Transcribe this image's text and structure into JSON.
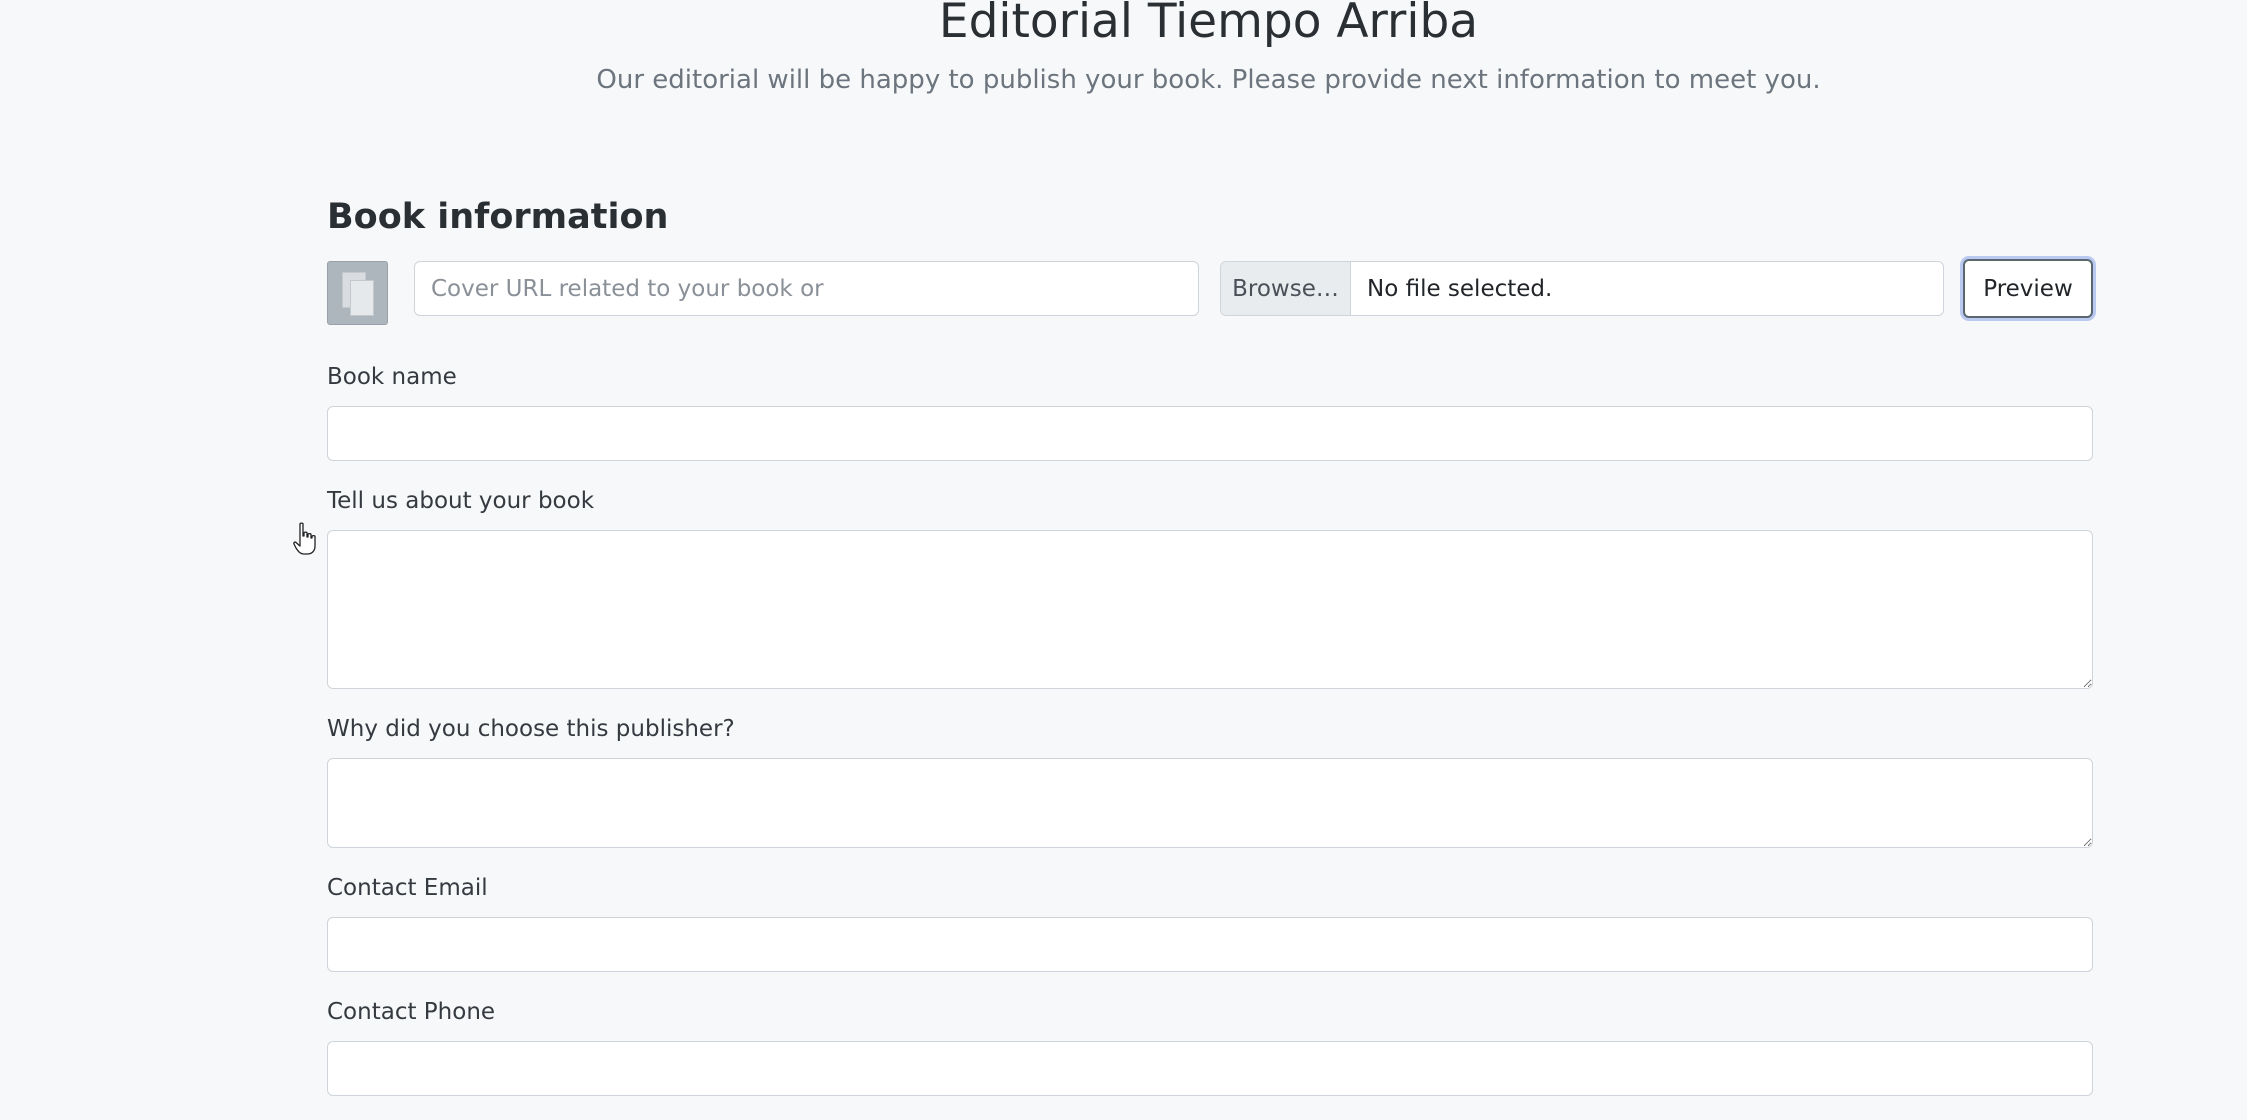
{
  "header": {
    "title": "Editorial Tiempo Arriba",
    "subtitle": "Our editorial will be happy to publish your book. Please provide next information to meet you."
  },
  "book_section": {
    "title": "Book information",
    "cover_url_placeholder": "Cover URL related to your book or",
    "cover_url_value": "",
    "file_browse_label": "Browse…",
    "file_status": "No file selected.",
    "preview_label": "Preview"
  },
  "fields": {
    "book_name": {
      "label": "Book name",
      "value": ""
    },
    "about_book": {
      "label": "Tell us about your book",
      "value": ""
    },
    "why_publisher": {
      "label": "Why did you choose this publisher?",
      "value": ""
    },
    "contact_email": {
      "label": "Contact Email",
      "value": ""
    },
    "contact_phone": {
      "label": "Contact Phone",
      "value": ""
    }
  },
  "icons": {
    "cover_placeholder": "document-copies-icon",
    "cursor": "hand-pointer-cursor-icon"
  },
  "colors": {
    "background": "#f7f8fa",
    "input_border": "#ced4da",
    "focus_ring": "#b9c9f0"
  }
}
